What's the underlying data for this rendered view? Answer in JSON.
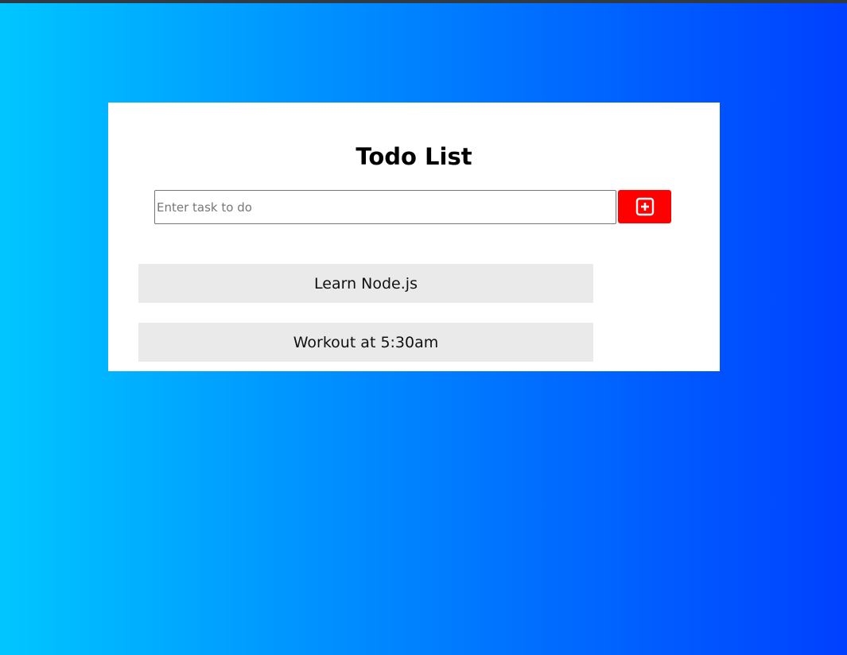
{
  "colors": {
    "background_start": "#00c6ff",
    "background_end": "#0040ff",
    "add_button": "#ff0000",
    "item_background": "#eaeaea"
  },
  "card": {
    "title": "Todo List"
  },
  "input": {
    "placeholder": "Enter task to do",
    "value": ""
  },
  "add_button": {
    "icon": "plus-square-icon"
  },
  "todos": [
    {
      "label": "Learn Node.js"
    },
    {
      "label": "Workout at 5:30am"
    }
  ]
}
